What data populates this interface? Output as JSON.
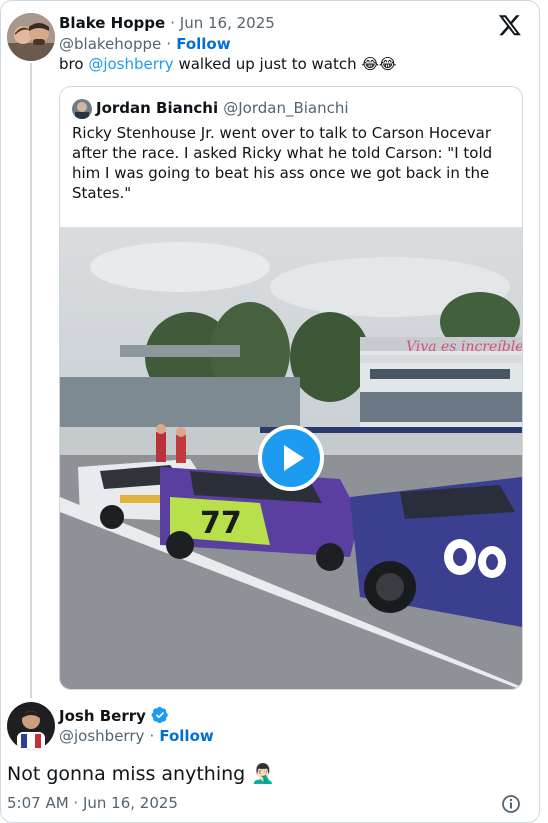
{
  "parent_tweet": {
    "author_name": "Blake Hoppe",
    "date": "· Jun 16, 2025",
    "handle": "@blakehoppe",
    "follow_separator": "·",
    "follow_label": "Follow",
    "text_before": "bro ",
    "mention": "@joshberry",
    "text_after": " walked up just to watch 😂😂"
  },
  "quoted_tweet": {
    "author_name": "Jordan Bianchi",
    "handle": "@Jordan_Bianchi",
    "text": "Ricky Stenhouse Jr. went over to talk to Carson Hocevar after the race. I asked Ricky what he told Carson: \"I told him I was going to beat his ass once we got back in the States.\"",
    "media": {
      "type": "video",
      "banner_text": "Viva es increíble",
      "car_numbers": [
        "77"
      ]
    }
  },
  "reply_tweet": {
    "author_name": "Josh Berry",
    "verified": true,
    "handle": "@joshberry",
    "follow_separator": "·",
    "follow_label": "Follow",
    "text": "Not gonna miss anything 🤦🏻‍♂️",
    "timestamp": "5:07 AM · Jun 16, 2025"
  },
  "icons": {
    "brand": "x-logo-icon",
    "play": "play-icon",
    "info": "info-icon",
    "verified": "verified-badge-icon"
  },
  "colors": {
    "link": "#1d9bf0",
    "follow": "#006fd6",
    "muted": "#536471",
    "border": "#cfd9de"
  }
}
